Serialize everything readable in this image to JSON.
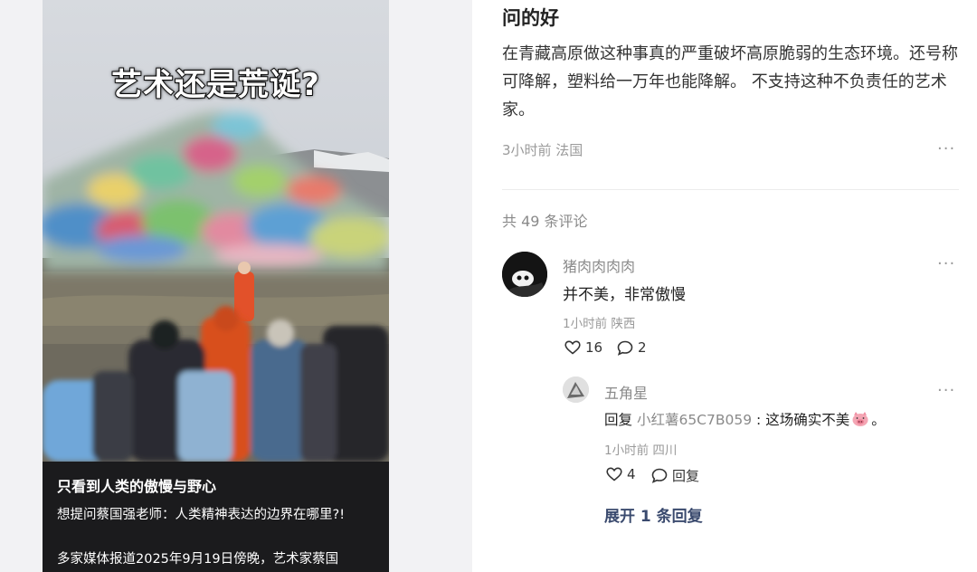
{
  "left": {
    "overlay_title": "艺术还是荒诞?",
    "headline": "只看到人类的傲慢与野心",
    "question": "想提问蔡国强老师：人类精神表达的边界在哪里?!",
    "news": "多家媒体报道2025年9月19日傍晚，艺术家蔡国"
  },
  "post": {
    "title": "问的好",
    "body": "在青藏高原做这种事真的严重破坏高原脆弱的生态环境。还号称可降解，塑料给一万年也能降解。 不支持这种不负责任的艺术家。",
    "meta": "3小时前 法国",
    "more": "···"
  },
  "comments_count": "共 49 条评论",
  "comment1": {
    "name": "猪肉肉肉肉",
    "text": "并不美，非常傲慢",
    "meta": "1小时前 陕西",
    "likes": "16",
    "replies": "2",
    "more": "···"
  },
  "reply1": {
    "name": "五角星",
    "prefix": "回复",
    "target": "小红薯65C7B059",
    "text": "这场确实不美",
    "end": "。",
    "meta": "1小时前 四川",
    "likes": "4",
    "reply_label": "回复",
    "more": "···"
  },
  "expand_label": "展开 1 条回复",
  "icons": {
    "like": "heart-outline-icon",
    "comment": "speech-bubble-icon",
    "emoji": "pig-face-emoji"
  }
}
